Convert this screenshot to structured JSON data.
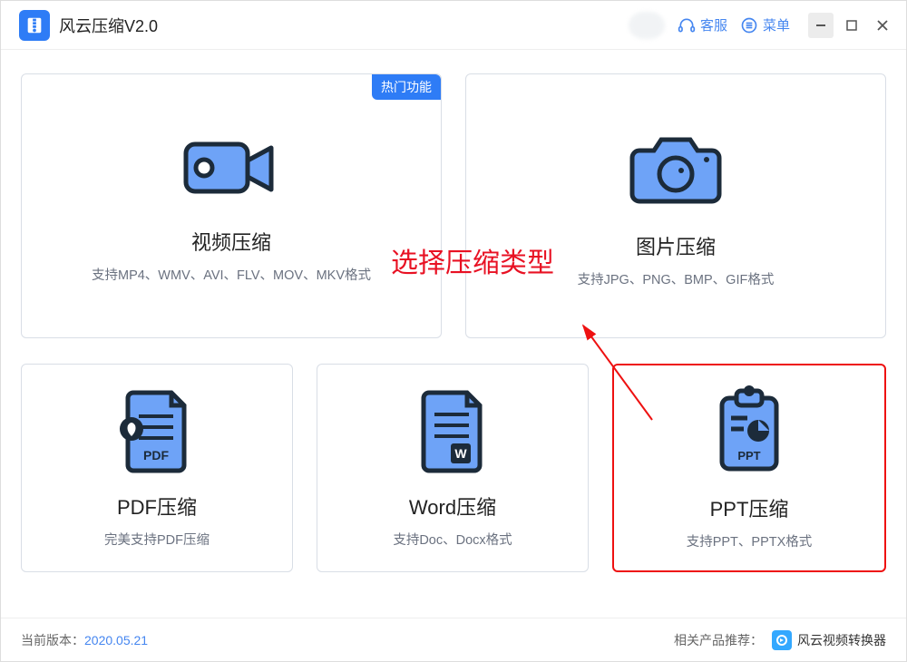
{
  "app": {
    "title": "风云压缩V2.0"
  },
  "titlebar": {
    "support": "客服",
    "menu": "菜单"
  },
  "cards": {
    "video": {
      "badge": "热门功能",
      "title": "视频压缩",
      "desc": "支持MP4、WMV、AVI、FLV、MOV、MKV格式"
    },
    "image": {
      "title": "图片压缩",
      "desc": "支持JPG、PNG、BMP、GIF格式"
    },
    "pdf": {
      "title": "PDF压缩",
      "desc": "完美支持PDF压缩"
    },
    "word": {
      "title": "Word压缩",
      "desc": "支持Doc、Docx格式"
    },
    "ppt": {
      "title": "PPT压缩",
      "desc": "支持PPT、PPTX格式"
    }
  },
  "annotation": "选择压缩类型",
  "footer": {
    "version_label": "当前版本：",
    "version": "2020.05.21",
    "related_label": "相关产品推荐：",
    "related_app": "风云视频转换器"
  }
}
